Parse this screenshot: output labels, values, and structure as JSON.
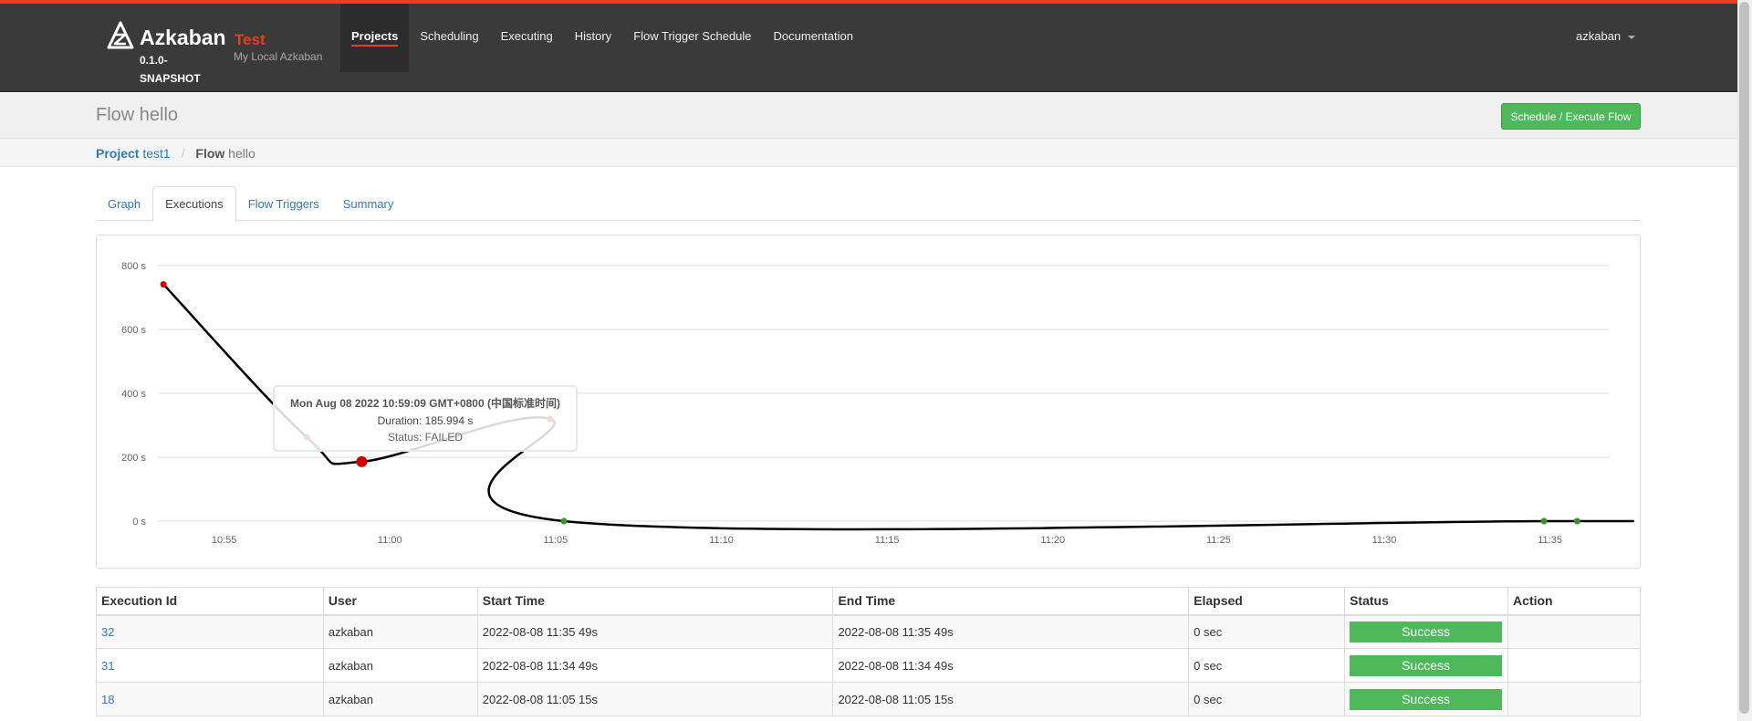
{
  "app": {
    "name": "Azkaban",
    "version": "0.1.0-SNAPSHOT",
    "env_name": "Test",
    "env_desc": "My Local Azkaban"
  },
  "nav": {
    "items": [
      {
        "label": "Projects",
        "active": true
      },
      {
        "label": "Scheduling"
      },
      {
        "label": "Executing"
      },
      {
        "label": "History"
      },
      {
        "label": "Flow Trigger Schedule"
      },
      {
        "label": "Documentation"
      }
    ],
    "user": "azkaban"
  },
  "header": {
    "title_prefix": "Flow",
    "title_name": "hello",
    "execute_button": "Schedule / Execute Flow"
  },
  "breadcrumb": {
    "project_key": "Project",
    "project_name": "test1",
    "separator": "/",
    "flow_key": "Flow",
    "flow_name": "hello"
  },
  "tabs": [
    {
      "label": "Graph"
    },
    {
      "label": "Executions",
      "active": true
    },
    {
      "label": "Flow Triggers"
    },
    {
      "label": "Summary"
    }
  ],
  "tooltip": {
    "title": "Mon Aug 08 2022 10:59:09 GMT+0800 (中国标准时间)",
    "duration": "Duration: 185.994 s",
    "status": "Status: FAILED"
  },
  "chart_data": {
    "type": "line",
    "x_ticks": [
      "10:55",
      "10:55",
      "11:00",
      "11:05",
      "11:10",
      "11:15",
      "11:20",
      "11:25",
      "11:30",
      "11:35"
    ],
    "y_ticks": [
      "0 s",
      "200 s",
      "400 s",
      "600 s",
      "800 s"
    ],
    "ylim": [
      0,
      800
    ],
    "xlim_minutes": [
      53.0,
      96.8
    ],
    "points": [
      {
        "t": "10:53:10",
        "x_min": 53.17,
        "y": 741,
        "status": "FAILED"
      },
      {
        "t": "10:57:30",
        "x_min": 57.5,
        "y": 262,
        "status": "FAILED"
      },
      {
        "t": "10:59:09",
        "x_min": 59.15,
        "y": 186,
        "status": "FAILED"
      },
      {
        "t": "11:04:50",
        "x_min": 64.83,
        "y": 320,
        "status": "FAILED"
      },
      {
        "t": "11:05:15",
        "x_min": 65.25,
        "y": 0,
        "status": "SUCCEEDED"
      },
      {
        "t": "11:34:49",
        "x_min": 94.82,
        "y": 0,
        "status": "SUCCEEDED"
      },
      {
        "t": "11:35:49",
        "x_min": 95.82,
        "y": 0,
        "status": "SUCCEEDED"
      }
    ],
    "colors": {
      "line": "#000000",
      "failed": "#cc0000",
      "success": "#3c8d2f",
      "grid": "#dddddd"
    },
    "grid": true
  },
  "table": {
    "columns": [
      "Execution Id",
      "User",
      "Start Time",
      "End Time",
      "Elapsed",
      "Status",
      "Action"
    ],
    "rows": [
      {
        "id": "32",
        "user": "azkaban",
        "start": "2022-08-08 11:35 49s",
        "end": "2022-08-08 11:35 49s",
        "elapsed": "0 sec",
        "status": "Success",
        "action": ""
      },
      {
        "id": "31",
        "user": "azkaban",
        "start": "2022-08-08 11:34 49s",
        "end": "2022-08-08 11:34 49s",
        "elapsed": "0 sec",
        "status": "Success",
        "action": ""
      },
      {
        "id": "18",
        "user": "azkaban",
        "start": "2022-08-08 11:05 15s",
        "end": "2022-08-08 11:05 15s",
        "elapsed": "0 sec",
        "status": "Success",
        "action": ""
      }
    ]
  }
}
